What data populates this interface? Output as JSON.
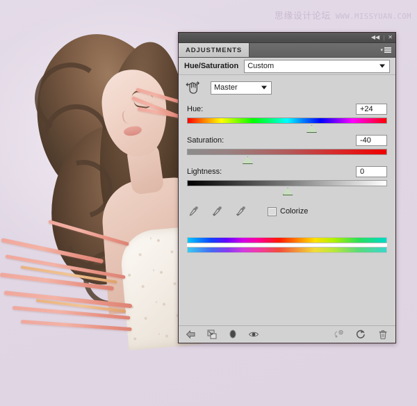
{
  "watermark": {
    "chinese": "思缘设计论坛",
    "url": "WWW.MISSYUAN.COM"
  },
  "panel": {
    "titlebar": {
      "collapse_label": "◀◀",
      "separator": "|",
      "close_label": "✕"
    },
    "tabs": [
      {
        "label": "ADJUSTMENTS",
        "active": true
      }
    ],
    "menu_icon": "panel-menu-icon",
    "preset_row": {
      "label": "Hue/Saturation",
      "preset_value": "Custom",
      "preset_placeholder": "Custom"
    },
    "channel_row": {
      "target_tool_icon": "targeted-adjustment-hand-icon",
      "channel_value": "Master"
    },
    "sliders": [
      {
        "label": "Hue:",
        "value": "+24",
        "track": "hue",
        "handle_pct": 62
      },
      {
        "label": "Saturation:",
        "value": "-40",
        "track": "sat",
        "handle_pct": 30
      },
      {
        "label": "Lightness:",
        "value": "0",
        "track": "light",
        "handle_pct": 50
      }
    ],
    "tools": {
      "eyedropper": "eyedropper-icon",
      "eyedropper_add": "eyedropper-add-icon",
      "eyedropper_subtract": "eyedropper-subtract-icon",
      "colorize_label": "Colorize",
      "colorize_checked": false
    },
    "spectrum": {
      "top_bar": "hue-spectrum-bar-source",
      "bottom_bar": "hue-spectrum-bar-result"
    },
    "footer": {
      "left": [
        {
          "name": "return-to-adjustment-list-icon",
          "glyph": "arrow-left"
        },
        {
          "name": "clip-to-layer-icon",
          "glyph": "clip"
        },
        {
          "name": "toggle-mask-icon",
          "glyph": "ellipse"
        },
        {
          "name": "toggle-visibility-icon",
          "glyph": "eye"
        }
      ],
      "right": [
        {
          "name": "preview-toggle-icon",
          "glyph": "preview"
        },
        {
          "name": "reset-icon",
          "glyph": "reset"
        },
        {
          "name": "delete-icon",
          "glyph": "trash"
        }
      ]
    }
  },
  "colors": {
    "panel_bg": "#d2d2d2",
    "panel_border": "#3a2a2e",
    "tab_active_bg": "#cccccc",
    "titlebar_bg": "#4f4f4f",
    "canvas_bg": "#e2d9e6",
    "handle_fill": "#c9e0c0",
    "accent_hair": "#54402f",
    "accent_strand": "#ef9f93"
  }
}
